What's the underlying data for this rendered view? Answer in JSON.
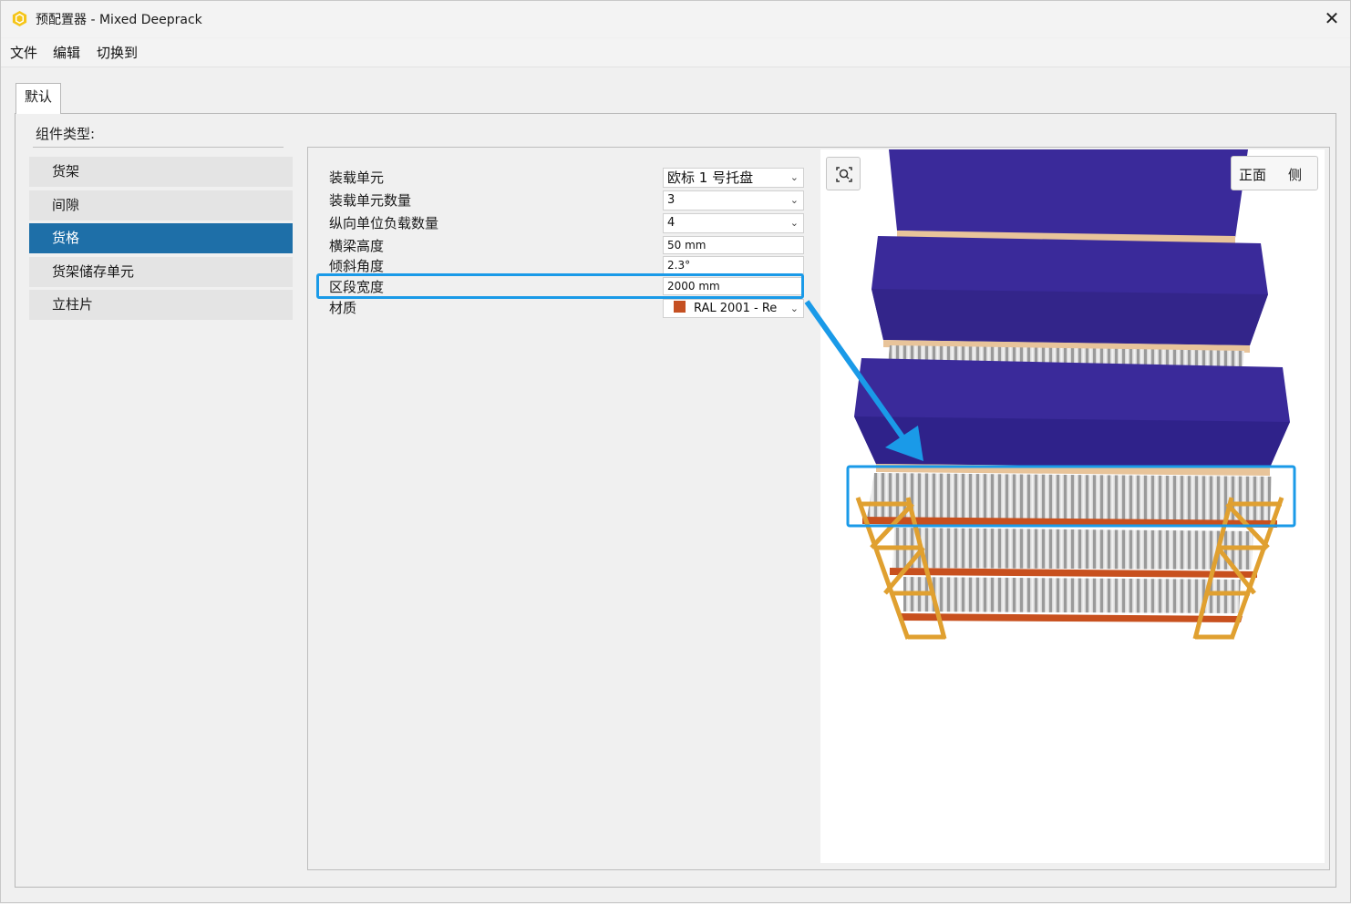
{
  "window": {
    "title": "预配置器 - Mixed Deeprack",
    "close_label": "✕"
  },
  "menu": {
    "file": "文件",
    "edit": "编辑",
    "switch_to": "切换到"
  },
  "tab": {
    "label": "默认"
  },
  "component_type_label": "组件类型:",
  "categories": [
    "货架",
    "间隙",
    "货格",
    "货架储存单元",
    "立柱片"
  ],
  "selected_category": "货格",
  "properties": [
    {
      "label": "装载单元",
      "value": "欧标 1 号托盘",
      "type": "dropdown"
    },
    {
      "label": "装载单元数量",
      "value": "3",
      "type": "dropdown"
    },
    {
      "label": "纵向单位负载数量",
      "value": "4",
      "type": "dropdown"
    },
    {
      "label": "横梁高度",
      "value": "50 mm",
      "type": "text"
    },
    {
      "label": "倾斜角度",
      "value": "2.3°",
      "type": "text"
    },
    {
      "label": "区段宽度",
      "value": "2000 mm",
      "type": "text"
    },
    {
      "label": "材质",
      "value": "RAL 2001 - Re",
      "type": "dropdown"
    }
  ],
  "highlighted_property": "区段宽度",
  "material_color": "#c55022",
  "viewer": {
    "view_front": "正面",
    "view_side": "侧"
  },
  "colors": {
    "accent": "#1e6fa8",
    "highlight": "#1a9ae8",
    "load": "#3a2a9a",
    "frame": "#e0a030",
    "beam": "#c8501e"
  },
  "icons": {
    "app": "hexagon-logo-icon",
    "zoom_fit": "zoom-fit-icon"
  }
}
